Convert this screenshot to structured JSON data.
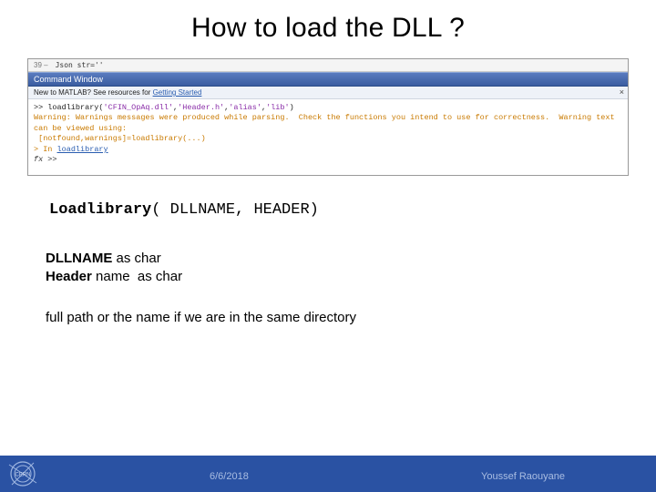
{
  "title": "How to load the DLL ?",
  "screenshot": {
    "tab": {
      "linenum": "39 –",
      "code": "Json str=''"
    },
    "window_title": "Command Window",
    "sub_prefix": "New to MATLAB? See resources for ",
    "sub_link": "Getting Started",
    "close": "×",
    "line1_a": ">> loadlibrary(",
    "line1_b": "'CFIN_OpAq.dll'",
    "line1_c": ",",
    "line1_d": "'Header.h'",
    "line1_e": ",",
    "line1_f": "'alias'",
    "line1_g": ",",
    "line1_h": "'lib'",
    "line1_i": ")",
    "warn1": "Warning: Warnings messages were produced while parsing.  Check the functions you intend to use for correctness.  Warning text",
    "warn2": "can be viewed using:",
    "warn3": " [notfound,warnings]=loadlibrary(...)",
    "warn4_a": "> In ",
    "warn4_b": "loadlibrary",
    "fx_prompt": "fx >>"
  },
  "code": {
    "func": "Loadlibrary",
    "open": "( ",
    "arg1": "DLLNAME",
    "comma": ", ",
    "arg2": "HEADER",
    "close": ")"
  },
  "notes": {
    "l1a": "DLLNAME",
    "l1b": " as char",
    "l2a": "Header",
    "l2b": " name  as char"
  },
  "fullpath": "full path or the name if we are in the same directory",
  "footer": {
    "logo_text": "CERN",
    "date": "6/6/2018",
    "author": "Youssef Raouyane"
  }
}
